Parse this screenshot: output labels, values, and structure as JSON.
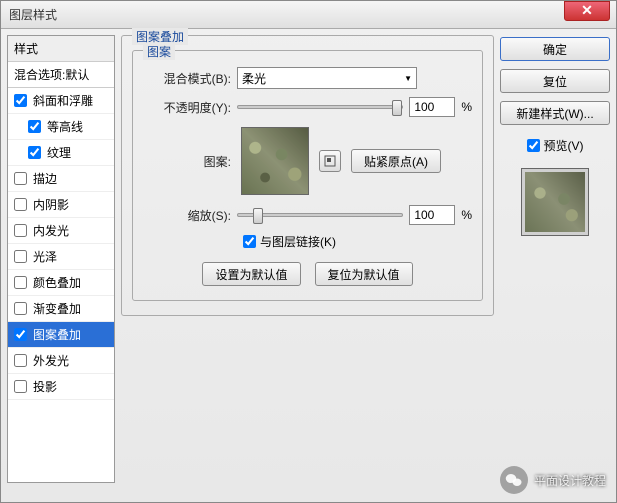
{
  "window": {
    "title": "图层样式"
  },
  "styles": {
    "header": "样式",
    "blending_default": "混合选项:默认",
    "items": [
      {
        "label": "斜面和浮雕",
        "checked": true,
        "indent": false
      },
      {
        "label": "等高线",
        "checked": true,
        "indent": true
      },
      {
        "label": "纹理",
        "checked": true,
        "indent": true
      },
      {
        "label": "描边",
        "checked": false,
        "indent": false
      },
      {
        "label": "内阴影",
        "checked": false,
        "indent": false
      },
      {
        "label": "内发光",
        "checked": false,
        "indent": false
      },
      {
        "label": "光泽",
        "checked": false,
        "indent": false
      },
      {
        "label": "颜色叠加",
        "checked": false,
        "indent": false
      },
      {
        "label": "渐变叠加",
        "checked": false,
        "indent": false
      },
      {
        "label": "图案叠加",
        "checked": true,
        "indent": false,
        "selected": true
      },
      {
        "label": "外发光",
        "checked": false,
        "indent": false
      },
      {
        "label": "投影",
        "checked": false,
        "indent": false
      }
    ]
  },
  "panel": {
    "group_title": "图案叠加",
    "inner_title": "图案",
    "blend_mode_label": "混合模式(B):",
    "blend_mode_value": "柔光",
    "opacity_label": "不透明度(Y):",
    "opacity_value": "100",
    "percent": "%",
    "pattern_label": "图案:",
    "snap_origin": "贴紧原点(A)",
    "scale_label": "缩放(S):",
    "scale_value": "100",
    "link_with_layer": "与图层链接(K)",
    "set_default": "设置为默认值",
    "reset_default": "复位为默认值"
  },
  "buttons": {
    "ok": "确定",
    "cancel": "复位",
    "new_style": "新建样式(W)...",
    "preview": "预览(V)"
  },
  "watermark": "平面设计教程"
}
